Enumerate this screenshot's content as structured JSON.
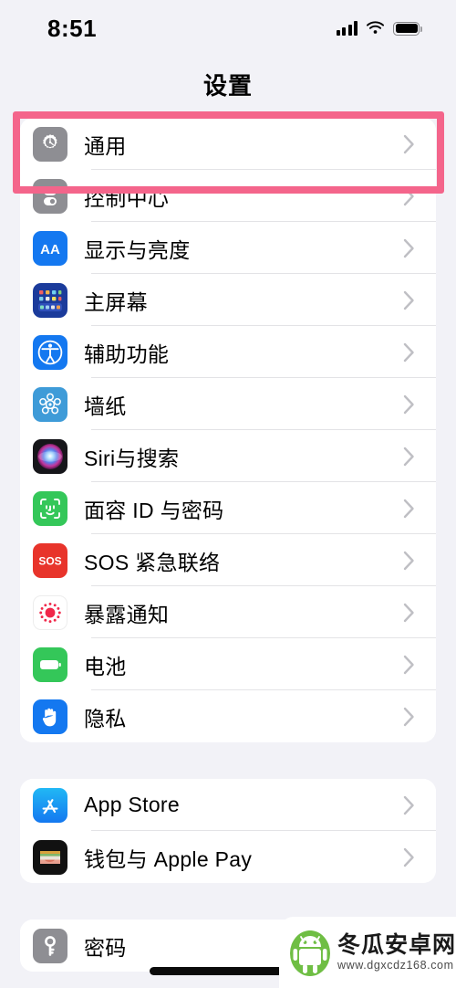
{
  "statusbar": {
    "time": "8:51",
    "signal_icon": "cellular-signal-icon",
    "wifi_icon": "wifi-icon",
    "battery_icon": "battery-full-icon"
  },
  "header": {
    "title": "设置"
  },
  "highlight": {
    "color": "#F4658B",
    "target_row": "通用"
  },
  "groups": [
    {
      "rows": [
        {
          "label": "通用",
          "icon": "gear-icon",
          "highlighted": true
        },
        {
          "label": "控制中心",
          "icon": "control-center-icon",
          "highlighted": false
        },
        {
          "label": "显示与亮度",
          "icon": "display-brightness-icon",
          "highlighted": false
        },
        {
          "label": "主屏幕",
          "icon": "home-screen-icon",
          "highlighted": false
        },
        {
          "label": "辅助功能",
          "icon": "accessibility-icon",
          "highlighted": false
        },
        {
          "label": "墙纸",
          "icon": "wallpaper-icon",
          "highlighted": false
        },
        {
          "label": "Siri与搜索",
          "icon": "siri-icon",
          "highlighted": false
        },
        {
          "label": "面容 ID 与密码",
          "icon": "face-id-icon",
          "highlighted": false
        },
        {
          "label": "SOS 紧急联络",
          "icon": "emergency-sos-icon",
          "highlighted": false
        },
        {
          "label": "暴露通知",
          "icon": "exposure-notification-icon",
          "highlighted": false
        },
        {
          "label": "电池",
          "icon": "battery-settings-icon",
          "highlighted": false
        },
        {
          "label": "隐私",
          "icon": "privacy-hand-icon",
          "highlighted": false
        }
      ]
    },
    {
      "rows": [
        {
          "label": "App Store",
          "icon": "app-store-icon",
          "highlighted": false
        },
        {
          "label": "钱包与 Apple Pay",
          "icon": "wallet-icon",
          "highlighted": false
        }
      ]
    },
    {
      "rows": [
        {
          "label": "密码",
          "icon": "passwords-key-icon",
          "highlighted": false
        }
      ]
    }
  ],
  "watermark": {
    "title": "冬瓜安卓网",
    "url": "www.dgxcdz168.com",
    "logo_icon": "android-mascot-icon",
    "color": "#6FBE44"
  },
  "chevron_icon": "chevron-right-icon",
  "home_indicator_icon": "home-indicator-bar"
}
